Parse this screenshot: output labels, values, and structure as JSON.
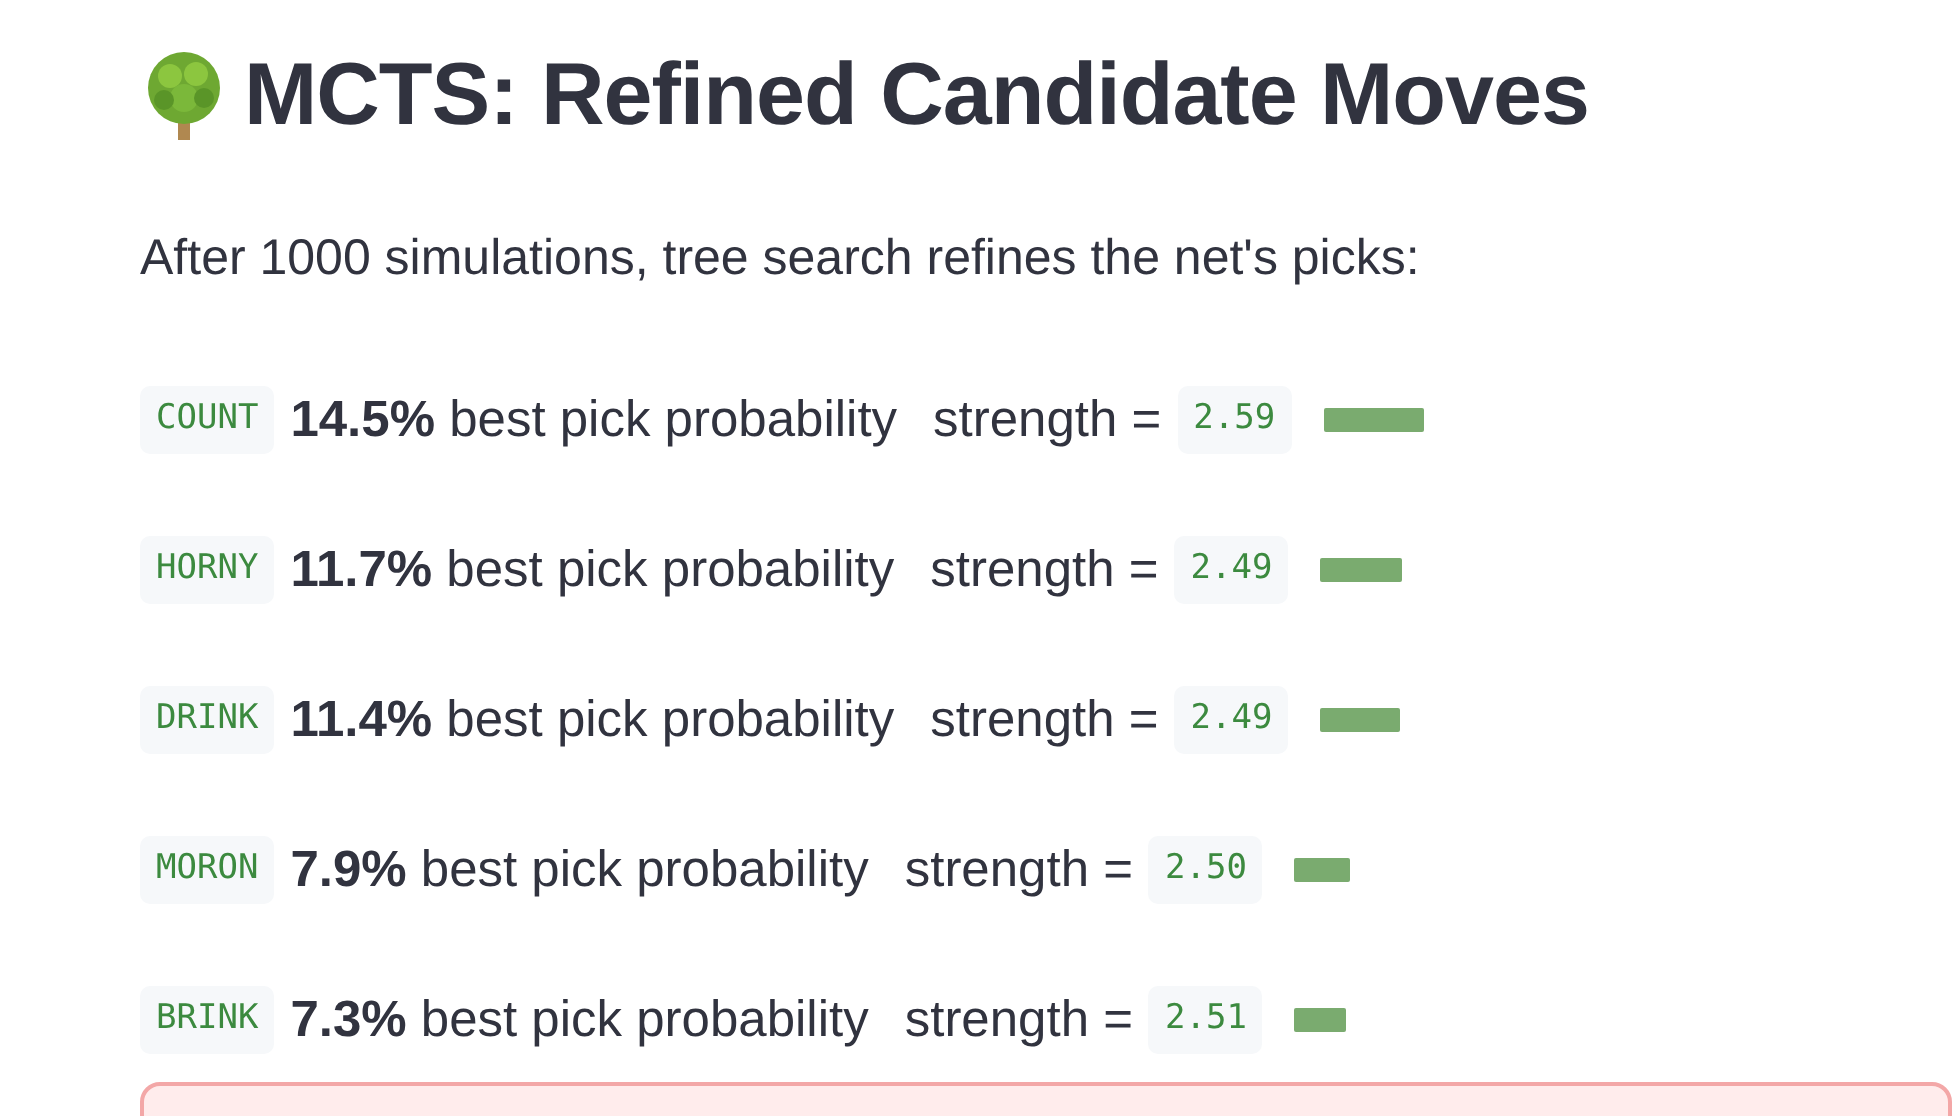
{
  "title": "MCTS: Refined Candidate Moves",
  "intro": "After 1000 simulations, tree search refines the net's picks:",
  "moves": [
    {
      "word": "COUNT",
      "probability": "**14.5%** best pick probability",
      "strength_label": "strength =",
      "strength": "2.59"
    },
    {
      "word": "HORNY",
      "probability": "**11.7%** best pick probability",
      "strength_label": "strength =",
      "strength": "2.49"
    },
    {
      "word": "DRINK",
      "probability": "**11.4%** best pick probability",
      "strength_label": "strength =",
      "strength": "2.49"
    },
    {
      "word": "MORON",
      "probability": "**7.9%** best pick probability",
      "strength_label": "strength =",
      "strength": "2.50"
    },
    {
      "word": "BRINK",
      "probability": "**7.3%** best pick probability",
      "strength_label": "strength =",
      "strength": "2.51"
    }
  ],
  "notice": {
    "kind": "error"
  }
}
